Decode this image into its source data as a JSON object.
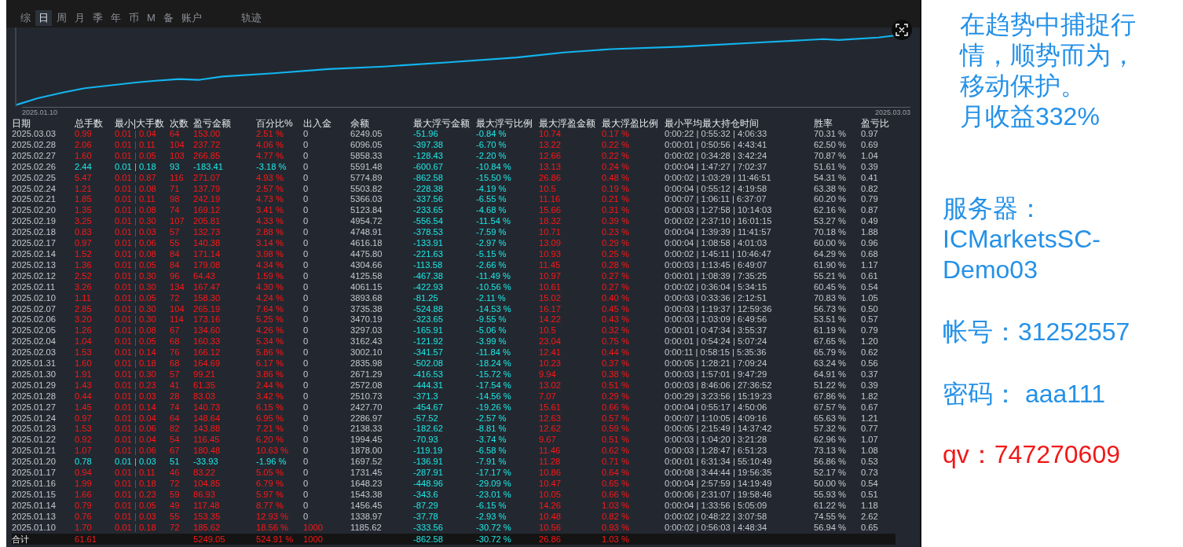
{
  "tabs": [
    {
      "label": "综",
      "selected": false
    },
    {
      "label": "日",
      "selected": true
    },
    {
      "label": "周",
      "selected": false
    },
    {
      "label": "月",
      "selected": false
    },
    {
      "label": "季",
      "selected": false
    },
    {
      "label": "年",
      "selected": false
    },
    {
      "label": "币",
      "selected": false
    },
    {
      "label": "M",
      "selected": false
    },
    {
      "label": "备",
      "selected": false
    },
    {
      "label": "账户",
      "selected": false
    },
    {
      "label": "轨迹",
      "selected": false
    }
  ],
  "equity_chart": {
    "start_label": "2025.01.10",
    "end_label": "2025.03.03"
  },
  "table": {
    "columns": [
      "日期",
      "总手数",
      "最小|大手数",
      "次数",
      "盈亏金额",
      "百分比%",
      "出入金",
      "余额",
      "最大浮亏金额",
      "最大浮亏比例",
      "最大浮盈金额",
      "最大浮盈比例",
      "最小平均最大持仓时间",
      "胜率",
      "盈亏比"
    ],
    "rows": [
      {
        "profitable": true,
        "cells": [
          "2025.03.03",
          "0.99",
          "0.01 | 0.04",
          "64",
          "153.00",
          "2.51 %",
          "0",
          "6249.05",
          "-51.96",
          "-0.84 %",
          "10.74",
          "0.17 %",
          "0:00:22 | 0:55:32 | 4:06:33",
          "70.31 %",
          "0.97"
        ]
      },
      {
        "profitable": true,
        "cells": [
          "2025.02.28",
          "2.06",
          "0.01 | 0.11",
          "104",
          "237.72",
          "4.06 %",
          "0",
          "6096.05",
          "-397.38",
          "-6.70 %",
          "13.22",
          "0.22 %",
          "0:00:01 | 0:50:56 | 4:43:41",
          "62.50 %",
          "0.69"
        ]
      },
      {
        "profitable": true,
        "cells": [
          "2025.02.27",
          "1.60",
          "0.01 | 0.05",
          "103",
          "266.85",
          "4.77 %",
          "0",
          "5858.33",
          "-128.43",
          "-2.20 %",
          "12.66",
          "0.22 %",
          "0:00:02 | 0:34:28 | 3:42:24",
          "70.87 %",
          "1.04"
        ]
      },
      {
        "profitable": false,
        "cells": [
          "2025.02.26",
          "2.44",
          "0.01 | 0.18",
          "93",
          "-183.41",
          "-3.18 %",
          "0",
          "5591.48",
          "-600.67",
          "-10.84 %",
          "13.13",
          "0.24 %",
          "0:00:04 | 1:47:27 | 7:02:37",
          "51.61 %",
          "0.39"
        ]
      },
      {
        "profitable": true,
        "cells": [
          "2025.02.25",
          "5.47",
          "0.01 | 0.87",
          "116",
          "271.07",
          "4.93 %",
          "0",
          "5774.89",
          "-862.58",
          "-15.50 %",
          "26.86",
          "0.48 %",
          "0:00:02 | 1:03:29 | 11:46:51",
          "54.31 %",
          "0.41"
        ]
      },
      {
        "profitable": true,
        "cells": [
          "2025.02.24",
          "1.21",
          "0.01 | 0.08",
          "71",
          "137.79",
          "2.57 %",
          "0",
          "5503.82",
          "-228.38",
          "-4.19 %",
          "10.5",
          "0.19 %",
          "0:00:04 | 0:55:12 | 4:19:58",
          "63.38 %",
          "0.82"
        ]
      },
      {
        "profitable": true,
        "cells": [
          "2025.02.21",
          "1.85",
          "0.01 | 0.11",
          "98",
          "242.19",
          "4.73 %",
          "0",
          "5366.03",
          "-337.56",
          "-6.55 %",
          "11.16",
          "0.21 %",
          "0:00:07 | 1:06:11 | 6:37:07",
          "60.20 %",
          "0.79"
        ]
      },
      {
        "profitable": true,
        "cells": [
          "2025.02.20",
          "1.35",
          "0.01 | 0.08",
          "74",
          "169.12",
          "3.41 %",
          "0",
          "5123.84",
          "-233.65",
          "-4.68 %",
          "15.66",
          "0.31 %",
          "0:00:03 | 1:27:58 | 10:14:03",
          "62.16 %",
          "0.87"
        ]
      },
      {
        "profitable": true,
        "cells": [
          "2025.02.19",
          "3.25",
          "0.01 | 0.30",
          "107",
          "205.81",
          "4.33 %",
          "0",
          "4954.72",
          "-556.54",
          "-11.54 %",
          "18.32",
          "0.39 %",
          "0:00:02 | 2:37:10 | 16:01:15",
          "53.27 %",
          "0.49"
        ]
      },
      {
        "profitable": true,
        "cells": [
          "2025.02.18",
          "0.83",
          "0.01 | 0.03",
          "57",
          "132.73",
          "2.88 %",
          "0",
          "4748.91",
          "-378.53",
          "-7.59 %",
          "10.71",
          "0.23 %",
          "0:00:04 | 1:39:39 | 11:41:57",
          "70.18 %",
          "1.88"
        ]
      },
      {
        "profitable": true,
        "cells": [
          "2025.02.17",
          "0.97",
          "0.01 | 0.06",
          "55",
          "140.38",
          "3.14 %",
          "0",
          "4616.18",
          "-133.91",
          "-2.97 %",
          "13.09",
          "0.29 %",
          "0:00:04 | 1:08:58 | 4:01:03",
          "60.00 %",
          "0.96"
        ]
      },
      {
        "profitable": true,
        "cells": [
          "2025.02.14",
          "1.52",
          "0.01 | 0.08",
          "84",
          "171.14",
          "3.98 %",
          "0",
          "4475.80",
          "-221.63",
          "-5.15 %",
          "10.93",
          "0.25 %",
          "0:00:02 | 1:45:11 | 10:46:47",
          "64.29 %",
          "0.68"
        ]
      },
      {
        "profitable": true,
        "cells": [
          "2025.02.13",
          "1.36",
          "0.01 | 0.05",
          "84",
          "179.08",
          "4.34 %",
          "0",
          "4304.66",
          "-113.58",
          "-2.66 %",
          "11.45",
          "0.28 %",
          "0:00:03 | 1:13:45 | 6:49:07",
          "61.90 %",
          "1.17"
        ]
      },
      {
        "profitable": true,
        "cells": [
          "2025.02.12",
          "2.52",
          "0.01 | 0.30",
          "96",
          "64.43",
          "1.59 %",
          "0",
          "4125.58",
          "-467.38",
          "-11.49 %",
          "10.97",
          "0.27 %",
          "0:00:01 | 1:08:39 | 7:35:25",
          "55.21 %",
          "0.61"
        ]
      },
      {
        "profitable": true,
        "cells": [
          "2025.02.11",
          "3.26",
          "0.01 | 0.30",
          "134",
          "167.47",
          "4.30 %",
          "0",
          "4061.15",
          "-422.93",
          "-10.56 %",
          "10.61",
          "0.27 %",
          "0:00:02 | 0:36:04 | 5:34:15",
          "60.45 %",
          "0.54"
        ]
      },
      {
        "profitable": true,
        "cells": [
          "2025.02.10",
          "1.11",
          "0.01 | 0.05",
          "72",
          "158.30",
          "4.24 %",
          "0",
          "3893.68",
          "-81.25",
          "-2.11 %",
          "15.02",
          "0.40 %",
          "0:00:03 | 0:33:36 | 2:12:51",
          "70.83 %",
          "1.05"
        ]
      },
      {
        "profitable": true,
        "cells": [
          "2025.02.07",
          "2.85",
          "0.01 | 0.30",
          "104",
          "265.19",
          "7.64 %",
          "0",
          "3735.38",
          "-524.88",
          "-14.53 %",
          "16.17",
          "0.45 %",
          "0:00:03 | 1:19:37 | 12:59:36",
          "56.73 %",
          "0.50"
        ]
      },
      {
        "profitable": true,
        "cells": [
          "2025.02.06",
          "3.20",
          "0.01 | 0.30",
          "114",
          "173.16",
          "5.25 %",
          "0",
          "3470.19",
          "-323.65",
          "-9.55 %",
          "14.22",
          "0.43 %",
          "0:00:03 | 1:03:09 | 6:49:56",
          "53.51 %",
          "0.57"
        ]
      },
      {
        "profitable": true,
        "cells": [
          "2025.02.05",
          "1.26",
          "0.01 | 0.08",
          "67",
          "134.60",
          "4.26 %",
          "0",
          "3297.03",
          "-165.91",
          "-5.06 %",
          "10.5",
          "0.32 %",
          "0:00:01 | 0:47:34 | 3:55:37",
          "61.19 %",
          "0.79"
        ]
      },
      {
        "profitable": true,
        "cells": [
          "2025.02.04",
          "1.04",
          "0.01 | 0.05",
          "68",
          "160.33",
          "5.34 %",
          "0",
          "3162.43",
          "-121.92",
          "-3.99 %",
          "23.04",
          "0.75 %",
          "0:00:01 | 0:54:24 | 5:07:24",
          "67.65 %",
          "1.20"
        ]
      },
      {
        "profitable": true,
        "cells": [
          "2025.02.03",
          "1.53",
          "0.01 | 0.14",
          "76",
          "166.12",
          "5.86 %",
          "0",
          "3002.10",
          "-341.57",
          "-11.84 %",
          "12.41",
          "0.44 %",
          "0:00:11 | 0:58:15 | 5:35:36",
          "65.79 %",
          "0.62"
        ]
      },
      {
        "profitable": true,
        "cells": [
          "2025.01.31",
          "1.60",
          "0.01 | 0.18",
          "68",
          "164.69",
          "6.17 %",
          "0",
          "2835.98",
          "-502.08",
          "-18.24 %",
          "10.23",
          "0.37 %",
          "0:00:05 | 1:28:21 | 7:09:24",
          "63.24 %",
          "0.56"
        ]
      },
      {
        "profitable": true,
        "cells": [
          "2025.01.30",
          "1.91",
          "0.01 | 0.30",
          "57",
          "99.21",
          "3.86 %",
          "0",
          "2671.29",
          "-416.53",
          "-15.72 %",
          "9.94",
          "0.38 %",
          "0:00:03 | 1:57:01 | 9:47:29",
          "64.91 %",
          "0.37"
        ]
      },
      {
        "profitable": true,
        "cells": [
          "2025.01.29",
          "1.43",
          "0.01 | 0.23",
          "41",
          "61.35",
          "2.44 %",
          "0",
          "2572.08",
          "-444.31",
          "-17.54 %",
          "13.02",
          "0.51 %",
          "0:00:03 | 8:46:06 | 27:36:52",
          "51.22 %",
          "0.39"
        ]
      },
      {
        "profitable": true,
        "cells": [
          "2025.01.28",
          "0.44",
          "0.01 | 0.03",
          "28",
          "83.03",
          "3.42 %",
          "0",
          "2510.73",
          "-371.3",
          "-14.56 %",
          "7.07",
          "0.29 %",
          "0:00:29 | 3:23:56 | 15:19:23",
          "67.86 %",
          "1.82"
        ]
      },
      {
        "profitable": true,
        "cells": [
          "2025.01.27",
          "1.45",
          "0.01 | 0.14",
          "74",
          "140.73",
          "6.15 %",
          "0",
          "2427.70",
          "-454.67",
          "-19.26 %",
          "15.61",
          "0.66 %",
          "0:00:04 | 0:55:17 | 4:50:06",
          "67.57 %",
          "0.67"
        ]
      },
      {
        "profitable": true,
        "cells": [
          "2025.01.24",
          "0.97",
          "0.01 | 0.04",
          "64",
          "148.64",
          "6.95 %",
          "0",
          "2286.97",
          "-57.52",
          "-2.57 %",
          "12.63",
          "0.57 %",
          "0:00:07 | 1:10:05 | 4:09:16",
          "65.63 %",
          "1.21"
        ]
      },
      {
        "profitable": true,
        "cells": [
          "2025.01.23",
          "1.53",
          "0.01 | 0.06",
          "82",
          "143.88",
          "7.21 %",
          "0",
          "2138.33",
          "-182.62",
          "-8.81 %",
          "12.62",
          "0.59 %",
          "0:00:05 | 2:15:49 | 14:37:42",
          "57.32 %",
          "0.77"
        ]
      },
      {
        "profitable": true,
        "cells": [
          "2025.01.22",
          "0.92",
          "0.01 | 0.04",
          "54",
          "116.45",
          "6.20 %",
          "0",
          "1994.45",
          "-70.93",
          "-3.74 %",
          "9.67",
          "0.51 %",
          "0:00:03 | 1:04:20 | 3:21:28",
          "62.96 %",
          "1.07"
        ]
      },
      {
        "profitable": true,
        "cells": [
          "2025.01.21",
          "1.07",
          "0.01 | 0.06",
          "67",
          "180.48",
          "10.63 %",
          "0",
          "1878.00",
          "-119.19",
          "-6.58 %",
          "11.46",
          "0.62 %",
          "0:00:03 | 1:28:47 | 6:51:23",
          "73.13 %",
          "1.08"
        ]
      },
      {
        "profitable": false,
        "cells": [
          "2025.01.20",
          "0.78",
          "0.01 | 0.03",
          "51",
          "-33.93",
          "-1.96 %",
          "0",
          "1697.52",
          "-136.91",
          "-7.91 %",
          "11.28",
          "0.71 %",
          "0:00:01 | 6:31:34 | 55:10:49",
          "56.86 %",
          "0.53"
        ]
      },
      {
        "profitable": true,
        "cells": [
          "2025.01.17",
          "0.94",
          "0.01 | 0.11",
          "46",
          "83.22",
          "5.05 %",
          "0",
          "1731.45",
          "-287.91",
          "-17.17 %",
          "10.86",
          "0.64 %",
          "0:00:08 | 3:44:44 | 19:56:35",
          "52.17 %",
          "0.73"
        ]
      },
      {
        "profitable": true,
        "cells": [
          "2025.01.16",
          "1.99",
          "0.01 | 0.18",
          "72",
          "104.85",
          "6.79 %",
          "0",
          "1648.23",
          "-448.96",
          "-29.09 %",
          "10.47",
          "0.65 %",
          "0:00:04 | 2:57:59 | 14:19:49",
          "50.00 %",
          "0.54"
        ]
      },
      {
        "profitable": true,
        "cells": [
          "2025.01.15",
          "1.66",
          "0.01 | 0.23",
          "59",
          "86.93",
          "5.97 %",
          "0",
          "1543.38",
          "-343.6",
          "-23.01 %",
          "10.05",
          "0.66 %",
          "0:00:06 | 2:31:07 | 19:58:46",
          "55.93 %",
          "0.51"
        ]
      },
      {
        "profitable": true,
        "cells": [
          "2025.01.14",
          "0.79",
          "0.01 | 0.05",
          "49",
          "117.48",
          "8.77 %",
          "0",
          "1456.45",
          "-87.29",
          "-6.15 %",
          "14.26",
          "1.03 %",
          "0:00:04 | 1:33:56 | 5:05:09",
          "61.22 %",
          "1.18"
        ]
      },
      {
        "profitable": true,
        "cells": [
          "2025.01.13",
          "0.76",
          "0.01 | 0.03",
          "55",
          "153.35",
          "12.93 %",
          "0",
          "1338.97",
          "-37.78",
          "-2.93 %",
          "10.48",
          "0.82 %",
          "0:00:02 | 0:48:22 | 3:07:58",
          "74.55 %",
          "2.62"
        ]
      },
      {
        "profitable": true,
        "cells": [
          "2025.01.10",
          "1.70",
          "0.01 | 0.18",
          "72",
          "185.62",
          "18.56 %",
          "1000",
          "1185.62",
          "-333.56",
          "-30.72 %",
          "10.56",
          "0.93 %",
          "0:00:02 | 0:56:03 | 4:48:34",
          "56.94 %",
          "0.65"
        ]
      }
    ],
    "total": {
      "label": "合计",
      "lots": "61.61",
      "profit": "5249.05",
      "percent": "524.91 %",
      "deposit": "1000",
      "max_float_loss": "-862.58",
      "max_float_loss_pct": "-30.72 %",
      "max_float_profit": "26.86",
      "max_float_profit_pct": "1.03 %"
    }
  },
  "notes": [
    {
      "kind": "info",
      "text": "在趋势中捕捉行情，顺势而为，移动保护。"
    },
    {
      "kind": "info",
      "text": "月收益332%"
    },
    {
      "kind": "info",
      "text": "服务器：ICMarketsSC-Demo03"
    },
    {
      "kind": "info",
      "text": "帐号：31252557"
    },
    {
      "kind": "info",
      "text": "密码： aaa111"
    },
    {
      "kind": "contact",
      "text": "qv：747270609"
    }
  ]
}
